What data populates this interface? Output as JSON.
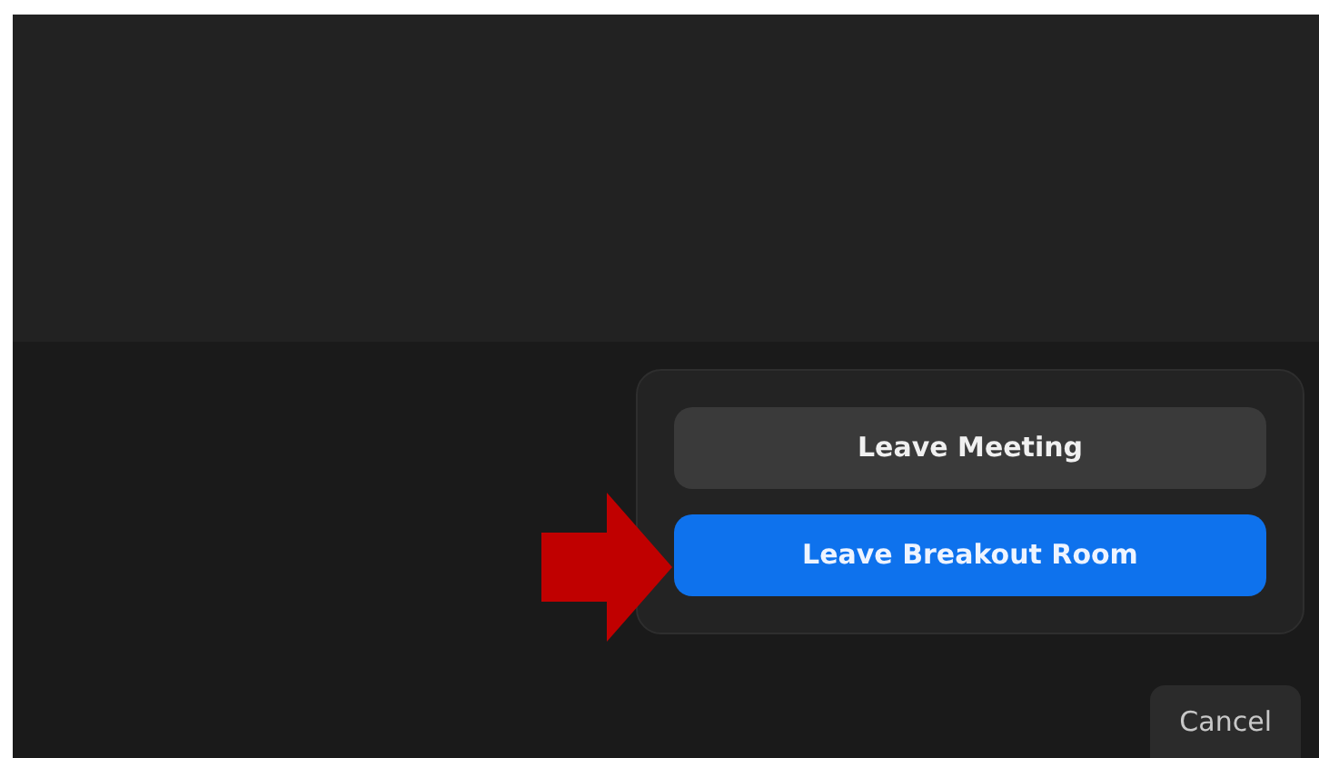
{
  "leave_menu": {
    "buttons": [
      {
        "label": "Leave Meeting",
        "kind": "secondary"
      },
      {
        "label": "Leave Breakout Room",
        "kind": "primary"
      }
    ]
  },
  "annotation": {
    "kind": "arrow"
  },
  "cancel_button": {
    "label": "Cancel"
  }
}
